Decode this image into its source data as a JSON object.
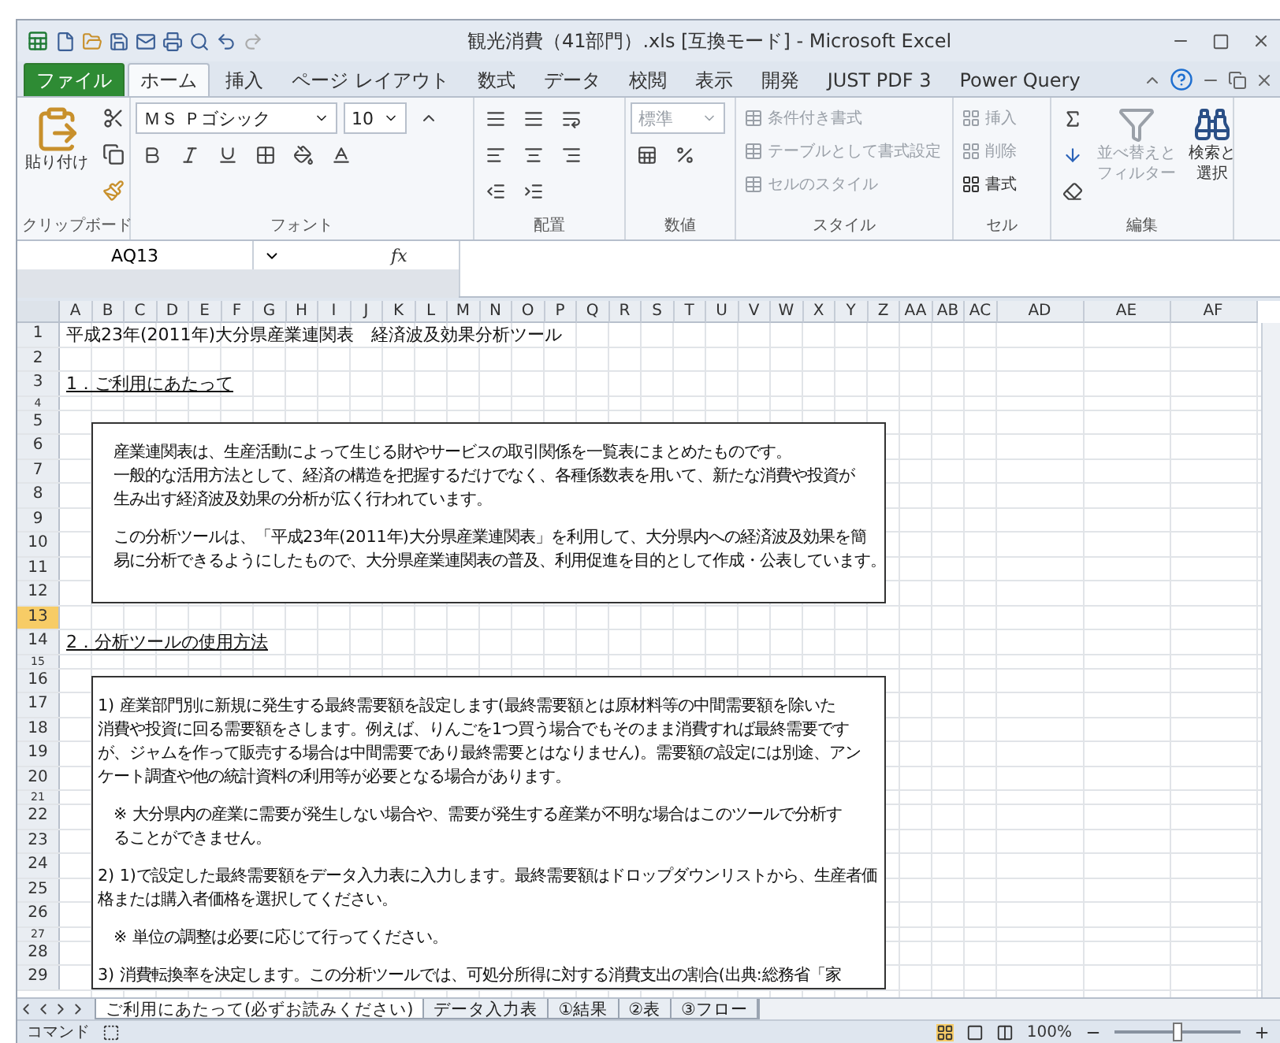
{
  "window": {
    "title": "観光消費（41部門）.xls [互換モード] - Microsoft Excel"
  },
  "ribbon_tabs": [
    {
      "label": "ファイル",
      "kind": "file",
      "selected": false
    },
    {
      "label": "ホーム",
      "kind": "tab",
      "selected": true
    },
    {
      "label": "挿入",
      "kind": "tab",
      "selected": false
    },
    {
      "label": "ページ レイアウト",
      "kind": "tab",
      "selected": false
    },
    {
      "label": "数式",
      "kind": "tab",
      "selected": false
    },
    {
      "label": "データ",
      "kind": "tab",
      "selected": false
    },
    {
      "label": "校閲",
      "kind": "tab",
      "selected": false
    },
    {
      "label": "表示",
      "kind": "tab",
      "selected": false
    },
    {
      "label": "開発",
      "kind": "tab",
      "selected": false
    },
    {
      "label": "JUST PDF 3",
      "kind": "tab",
      "selected": false
    },
    {
      "label": "Power Query",
      "kind": "tab",
      "selected": false
    }
  ],
  "clipboard": {
    "paste": "貼り付け",
    "label": "クリップボード"
  },
  "font": {
    "name": "ＭＳ Ｐゴシック",
    "size": "10",
    "label": "フォント"
  },
  "alignment": {
    "label": "配置"
  },
  "number": {
    "format": "標準",
    "label": "数値"
  },
  "styles": {
    "label": "スタイル",
    "items": [
      {
        "label": "条件付き書式",
        "disabled": true
      },
      {
        "label": "テーブルとして書式設定",
        "disabled": true
      },
      {
        "label": "セルのスタイル",
        "disabled": true
      }
    ]
  },
  "cells": {
    "label": "セル",
    "items": [
      {
        "label": "挿入",
        "disabled": true
      },
      {
        "label": "削除",
        "disabled": true
      },
      {
        "label": "書式",
        "disabled": false
      }
    ]
  },
  "editing": {
    "label": "編集",
    "sort": {
      "lines": [
        "並べ替えと",
        "フィルター"
      ],
      "disabled": true
    },
    "find": {
      "lines": [
        "検索と",
        "選択"
      ],
      "disabled": false
    }
  },
  "formula_bar": {
    "name_box": "AQ13",
    "fx": "fx"
  },
  "columns": [
    {
      "label": "A",
      "kind": "narrow"
    },
    {
      "label": "B",
      "kind": "narrow"
    },
    {
      "label": "C",
      "kind": "narrow"
    },
    {
      "label": "D",
      "kind": "narrow"
    },
    {
      "label": "E",
      "kind": "narrow"
    },
    {
      "label": "F",
      "kind": "narrow"
    },
    {
      "label": "G",
      "kind": "narrow"
    },
    {
      "label": "H",
      "kind": "narrow"
    },
    {
      "label": "I",
      "kind": "narrow"
    },
    {
      "label": "J",
      "kind": "narrow"
    },
    {
      "label": "K",
      "kind": "narrow"
    },
    {
      "label": "L",
      "kind": "narrow"
    },
    {
      "label": "M",
      "kind": "narrow"
    },
    {
      "label": "N",
      "kind": "narrow"
    },
    {
      "label": "O",
      "kind": "narrow"
    },
    {
      "label": "P",
      "kind": "narrow"
    },
    {
      "label": "Q",
      "kind": "narrow"
    },
    {
      "label": "R",
      "kind": "narrow"
    },
    {
      "label": "S",
      "kind": "narrow"
    },
    {
      "label": "T",
      "kind": "narrow"
    },
    {
      "label": "U",
      "kind": "narrow"
    },
    {
      "label": "V",
      "kind": "narrow"
    },
    {
      "label": "W",
      "kind": "narrow"
    },
    {
      "label": "X",
      "kind": "narrow"
    },
    {
      "label": "Y",
      "kind": "narrow"
    },
    {
      "label": "Z",
      "kind": "narrow"
    },
    {
      "label": "AA",
      "kind": "narrow"
    },
    {
      "label": "AB",
      "kind": "narrow"
    },
    {
      "label": "AC",
      "kind": "narrow"
    },
    {
      "label": "AD",
      "kind": "wide"
    },
    {
      "label": "AE",
      "kind": "wide"
    },
    {
      "label": "AF",
      "kind": "wide"
    }
  ],
  "rows": [
    {
      "label": "1",
      "short": false,
      "selected": false,
      "text": "平成23年(2011年)大分県産業連関表　経済波及効果分析ツール",
      "kind": "title"
    },
    {
      "label": "2",
      "short": false,
      "selected": false
    },
    {
      "label": "3",
      "short": false,
      "selected": false,
      "text": "1．ご利用にあたって",
      "kind": "heading"
    },
    {
      "label": "4",
      "short": true,
      "selected": false
    },
    {
      "label": "5",
      "short": false,
      "selected": false
    },
    {
      "label": "6",
      "short": false,
      "selected": false
    },
    {
      "label": "7",
      "short": false,
      "selected": false
    },
    {
      "label": "8",
      "short": false,
      "selected": false
    },
    {
      "label": "9",
      "short": false,
      "selected": false
    },
    {
      "label": "10",
      "short": false,
      "selected": false
    },
    {
      "label": "11",
      "short": false,
      "selected": false
    },
    {
      "label": "12",
      "short": false,
      "selected": false
    },
    {
      "label": "13",
      "short": false,
      "selected": true
    },
    {
      "label": "14",
      "short": false,
      "selected": false,
      "text": "2．分析ツールの使用方法",
      "kind": "heading"
    },
    {
      "label": "15",
      "short": true,
      "selected": false
    },
    {
      "label": "16",
      "short": false,
      "selected": false
    },
    {
      "label": "17",
      "short": false,
      "selected": false
    },
    {
      "label": "18",
      "short": false,
      "selected": false
    },
    {
      "label": "19",
      "short": false,
      "selected": false
    },
    {
      "label": "20",
      "short": false,
      "selected": false
    },
    {
      "label": "21",
      "short": true,
      "selected": false
    },
    {
      "label": "22",
      "short": false,
      "selected": false
    },
    {
      "label": "23",
      "short": false,
      "selected": false
    },
    {
      "label": "24",
      "short": false,
      "selected": false
    },
    {
      "label": "25",
      "short": false,
      "selected": false
    },
    {
      "label": "26",
      "short": false,
      "selected": false
    },
    {
      "label": "27",
      "short": true,
      "selected": false
    },
    {
      "label": "28",
      "short": false,
      "selected": false
    },
    {
      "label": "29",
      "short": false,
      "selected": false
    }
  ],
  "text_boxes": [
    {
      "paragraphs": [
        {
          "lines": [
            "産業連関表は、生産活動によって生じる財やサービスの取引関係を一覧表にまとめたものです。"
          ],
          "indented": true,
          "gap_before": true
        },
        {
          "lines": [
            "一般的な活用方法として、経済の構造を把握するだけでなく、各種係数表を用いて、新たな消費や投資が",
            "生み出す経済波及効果の分析が広く行われています。"
          ],
          "indented": true,
          "gap_before": false
        },
        {
          "lines": [
            "この分析ツールは、「平成23年(2011年)大分県産業連関表」を利用して、大分県内への経済波及効果を簡",
            "易に分析できるようにしたもので、大分県産業連関表の普及、利用促進を目的として作成・公表しています。"
          ],
          "indented": true,
          "gap_before": true
        }
      ]
    },
    {
      "paragraphs": [
        {
          "lines": [
            "1) 産業部門別に新規に発生する最終需要額を設定します(最終需要額とは原材料等の中間需要額を除いた",
            "消費や投資に回る需要額をさします。例えば、りんごを1つ買う場合でもそのまま消費すれば最終需要です",
            "が、ジャムを作って販売する場合は中間需要であり最終需要とはなりません)。需要額の設定には別途、アン",
            "ケート調査や他の統計資料の利用等が必要となる場合があります。"
          ],
          "indented": false,
          "gap_before": true
        },
        {
          "lines": [
            "※ 大分県内の産業に需要が発生しない場合や、需要が発生する産業が不明な場合はこのツールで分析す",
            "ることができません。"
          ],
          "indented": true,
          "gap_before": true
        },
        {
          "lines": [
            "2)  1)で設定した最終需要額をデータ入力表に入力します。最終需要額はドロップダウンリストから、生産者価",
            "格または購入者価格を選択してください。"
          ],
          "indented": false,
          "gap_before": true
        },
        {
          "lines": [
            "※ 単位の調整は必要に応じて行ってください。"
          ],
          "indented": true,
          "gap_before": true
        },
        {
          "lines": [
            "3) 消費転換率を決定します。この分析ツールでは、可処分所得に対する消費支出の割合(出典:総務省「家"
          ],
          "indented": false,
          "gap_before": true
        }
      ]
    }
  ],
  "sheet_tabs": [
    {
      "label": "ご利用にあたって(必ずお読みください)",
      "selected": true
    },
    {
      "label": "データ入力表",
      "selected": false
    },
    {
      "label": "①結果",
      "selected": false
    },
    {
      "label": "②表",
      "selected": false
    },
    {
      "label": "③フロー",
      "selected": false
    }
  ],
  "status_bar": {
    "mode": "コマンド",
    "zoom": "100%",
    "level": 0.5
  }
}
